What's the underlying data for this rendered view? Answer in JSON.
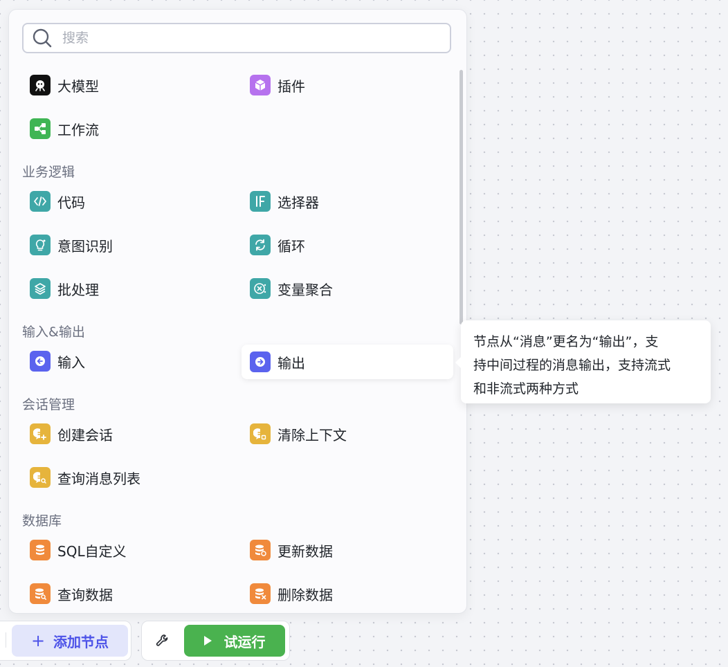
{
  "search": {
    "placeholder": "搜索",
    "value": ""
  },
  "top_items": [
    {
      "label": "大模型",
      "icon": "llm-icon",
      "color": "#111111"
    },
    {
      "label": "插件",
      "icon": "plugin-cube-icon",
      "color": "#b672ee"
    },
    {
      "label": "工作流",
      "icon": "workflow-icon",
      "color": "#3fb554"
    }
  ],
  "sections": [
    {
      "title": "业务逻辑",
      "items": [
        {
          "label": "代码",
          "icon": "code-icon",
          "color": "#3fa7a7"
        },
        {
          "label": "选择器",
          "icon": "if-selector-icon",
          "color": "#3fa7a7"
        },
        {
          "label": "意图识别",
          "icon": "intent-bulb-icon",
          "color": "#3fa7a7"
        },
        {
          "label": "循环",
          "icon": "loop-icon",
          "color": "#3fa7a7"
        },
        {
          "label": "批处理",
          "icon": "batch-layers-icon",
          "color": "#3fa7a7"
        },
        {
          "label": "变量聚合",
          "icon": "variable-aggregate-icon",
          "color": "#3fa7a7"
        }
      ]
    },
    {
      "title": "输入&输出",
      "items": [
        {
          "label": "输入",
          "icon": "input-arrow-icon",
          "color": "#5b63ee"
        },
        {
          "label": "输出",
          "icon": "output-arrow-icon",
          "color": "#5b63ee"
        }
      ]
    },
    {
      "title": "会话管理",
      "items": [
        {
          "label": "创建会话",
          "icon": "create-conversation-icon",
          "color": "#e6b43c"
        },
        {
          "label": "清除上下文",
          "icon": "clear-context-icon",
          "color": "#e6b43c"
        },
        {
          "label": "查询消息列表",
          "icon": "query-messages-icon",
          "color": "#e6b43c"
        }
      ]
    },
    {
      "title": "数据库",
      "items": [
        {
          "label": "SQL自定义",
          "icon": "database-icon",
          "color": "#f08a3c"
        },
        {
          "label": "更新数据",
          "icon": "database-update-icon",
          "color": "#f08a3c"
        },
        {
          "label": "查询数据",
          "icon": "database-search-icon",
          "color": "#f08a3c"
        },
        {
          "label": "删除数据",
          "icon": "database-delete-icon",
          "color": "#f08a3c"
        }
      ]
    }
  ],
  "tooltip": {
    "lines": [
      "节点从“消息”更名为“输出”，支",
      "持中间过程的消息输出，支持流式",
      "和非流式两种方式"
    ]
  },
  "toolbar": {
    "add_node_label": "添加节点",
    "add_node_icon": "plus-icon",
    "settings_icon": "wrench-icon",
    "run_label": "试运行",
    "run_icon": "play-icon",
    "run_color": "#4ab24f",
    "accent_color": "#4d53e8"
  }
}
